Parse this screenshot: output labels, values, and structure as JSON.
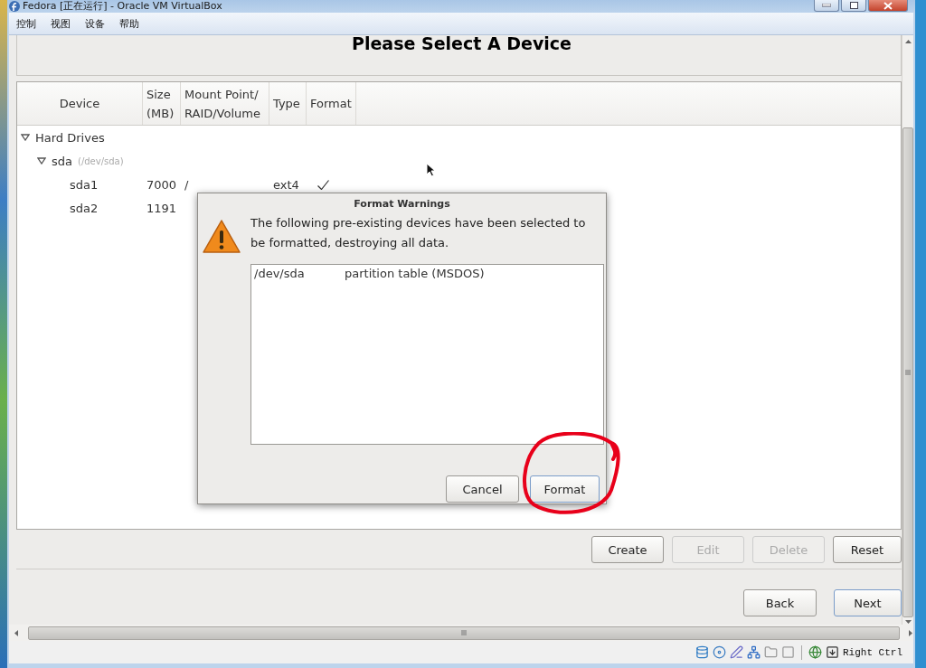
{
  "window": {
    "title": "Fedora [正在运行] - Oracle VM VirtualBox"
  },
  "menu": [
    "控制",
    "视图",
    "设备",
    "帮助"
  ],
  "page_title": "Please Select A Device",
  "table": {
    "columns": [
      "Device",
      "Size\n(MB)",
      "Mount Point/\nRAID/Volume",
      "Type",
      "Format"
    ],
    "tree": [
      {
        "label": "Hard Drives",
        "expanded": true,
        "children": [
          {
            "label": "sda",
            "path": "(/dev/sda)",
            "expanded": true,
            "children": [
              {
                "label": "sda1",
                "size": "7000",
                "mount": "/",
                "type": "ext4",
                "format": true
              },
              {
                "label": "sda2",
                "size": "1191"
              }
            ]
          }
        ]
      }
    ]
  },
  "buttons": [
    {
      "label": "Create",
      "disabled": false
    },
    {
      "label": "Edit",
      "disabled": true
    },
    {
      "label": "Delete",
      "disabled": true
    },
    {
      "label": "Reset",
      "disabled": false
    }
  ],
  "nav": [
    {
      "label": "Back",
      "default": false
    },
    {
      "label": "Next",
      "default": true
    }
  ],
  "dialog": {
    "title": "Format Warnings",
    "message": "The following pre-existing devices have been selected to be formatted, destroying all data.",
    "items": [
      {
        "device": "/dev/sda",
        "description": "partition table (MSDOS)"
      }
    ],
    "buttons": [
      {
        "label": "Cancel",
        "default": false
      },
      {
        "label": "Format",
        "default": true
      }
    ]
  },
  "status_bar": {
    "host_key": "Right Ctrl"
  }
}
